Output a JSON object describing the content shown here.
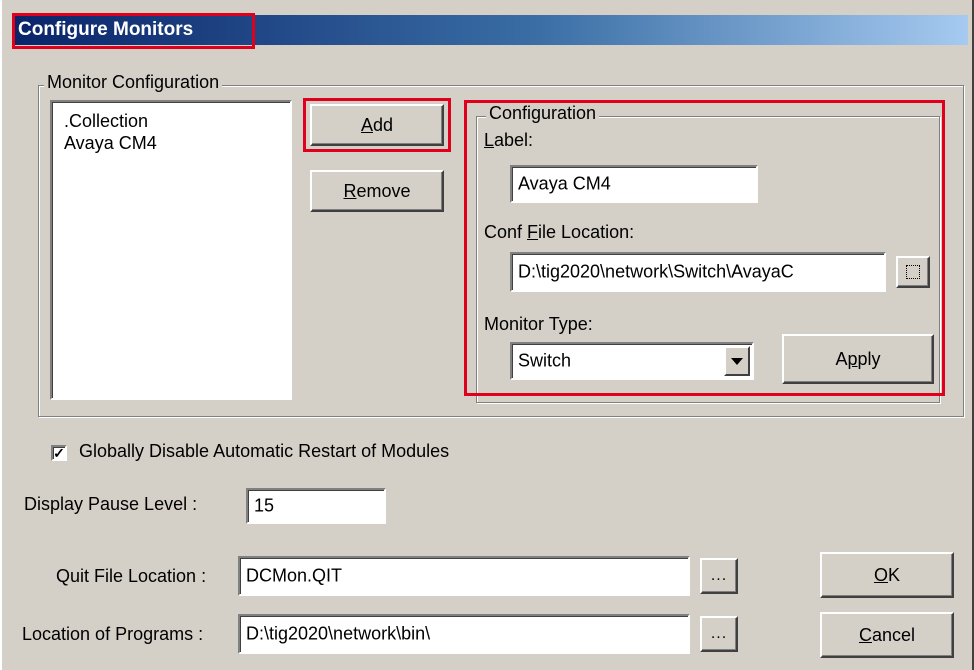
{
  "window": {
    "title": "Configure Monitors"
  },
  "monitor_configuration": {
    "legend": "Monitor Configuration",
    "items": [
      ".Collection",
      "Avaya CM4"
    ],
    "add_label": "Add",
    "add_mnemonic": "A",
    "add_rest": "dd",
    "remove_mnemonic": "R",
    "remove_rest": "emove"
  },
  "configuration": {
    "legend": "Configuration",
    "label_mnemonic": "L",
    "label_rest": "abel:",
    "label_value": "Avaya CM4",
    "conf_pre": "Conf ",
    "conf_mnemonic": "F",
    "conf_rest": "ile Location:",
    "conf_value": "D:\\tig2020\\network\\Switch\\AvayaC",
    "monitor_type_label": "Monitor Type:",
    "monitor_type_value": "Switch",
    "apply_pre": "A",
    "apply_mnemonic": "p",
    "apply_rest": "ply"
  },
  "options": {
    "disable_restart_label": "Globally Disable Automatic Restart of Modules",
    "disable_restart_checked": true,
    "check_mark": "✓",
    "pause_label": "Display Pause Level :",
    "pause_value": "15",
    "quit_label": "Quit File Location :",
    "quit_value": "DCMon.QIT",
    "programs_label": "Location of Programs :",
    "programs_value": "D:\\tig2020\\network\\bin\\",
    "browse_dots": "..."
  },
  "buttons": {
    "ok_mnemonic": "O",
    "ok_rest": "K",
    "cancel_mnemonic": "C",
    "cancel_rest": "ancel"
  },
  "colors": {
    "highlight": "#e0001b",
    "titlebar_start": "#0a246a",
    "titlebar_end": "#a6caf0",
    "face": "#d4d0c8"
  }
}
